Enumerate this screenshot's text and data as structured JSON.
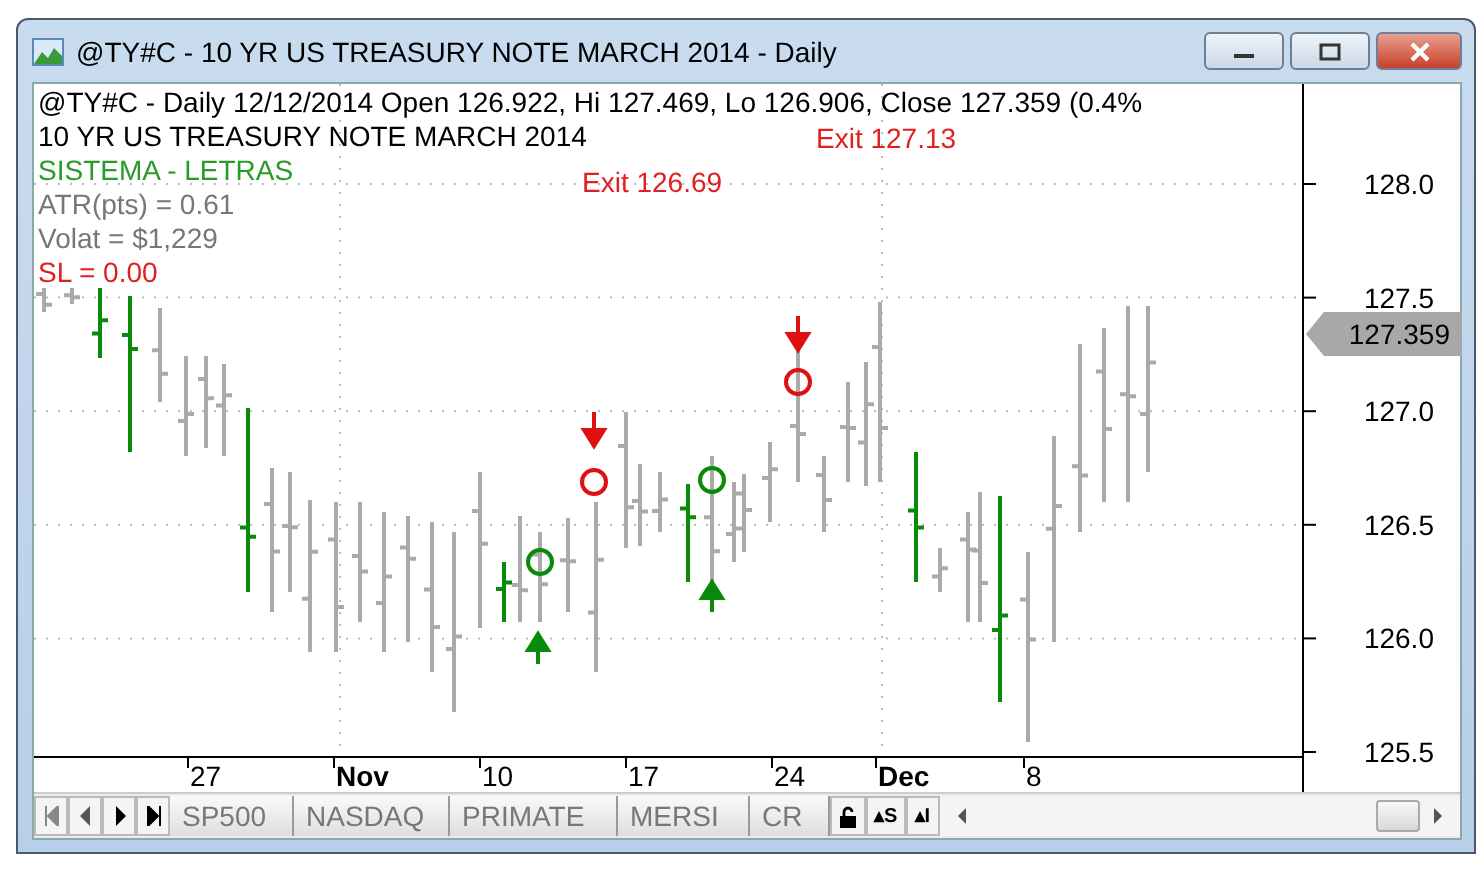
{
  "window": {
    "title": "@TY#C - 10 YR US TREASURY NOTE MARCH 2014 - Daily"
  },
  "header": {
    "quote_line": "@TY#C - Daily 12/12/2014 Open 126.922, Hi 127.469, Lo 126.906, Close 127.359 (0.4%",
    "symbol_name": "10 YR US TREASURY NOTE MARCH 2014"
  },
  "study": {
    "name": "SISTEMA - LETRAS",
    "lines": [
      {
        "text": "ATR(pts) = 0.61",
        "kind": "info"
      },
      {
        "text": "Volat = $1,229",
        "kind": "info"
      },
      {
        "text": "SL = 0.00",
        "kind": "stop"
      }
    ]
  },
  "exit_labels": [
    "Exit 127.13",
    "Exit 126.69"
  ],
  "y_axis": [
    "128.0",
    "127.5",
    "127.0",
    "126.5",
    "126.0",
    "125.5"
  ],
  "last_price": "127.359",
  "x_axis": [
    {
      "label": "27",
      "bold": false
    },
    {
      "label": "Nov",
      "bold": true
    },
    {
      "label": "10",
      "bold": false
    },
    {
      "label": "17",
      "bold": false
    },
    {
      "label": "24",
      "bold": false
    },
    {
      "label": "Dec",
      "bold": true
    },
    {
      "label": "8",
      "bold": false
    }
  ],
  "tabs": [
    {
      "label": "SP500",
      "selected": false
    },
    {
      "label": "NASDAQ",
      "selected": false
    },
    {
      "label": "PRIMATE",
      "selected": false
    },
    {
      "label": "MERSI",
      "selected": false
    },
    {
      "label": "CR",
      "selected": false
    }
  ],
  "toolbar_buttons": [
    "▴S",
    "▴I"
  ]
}
